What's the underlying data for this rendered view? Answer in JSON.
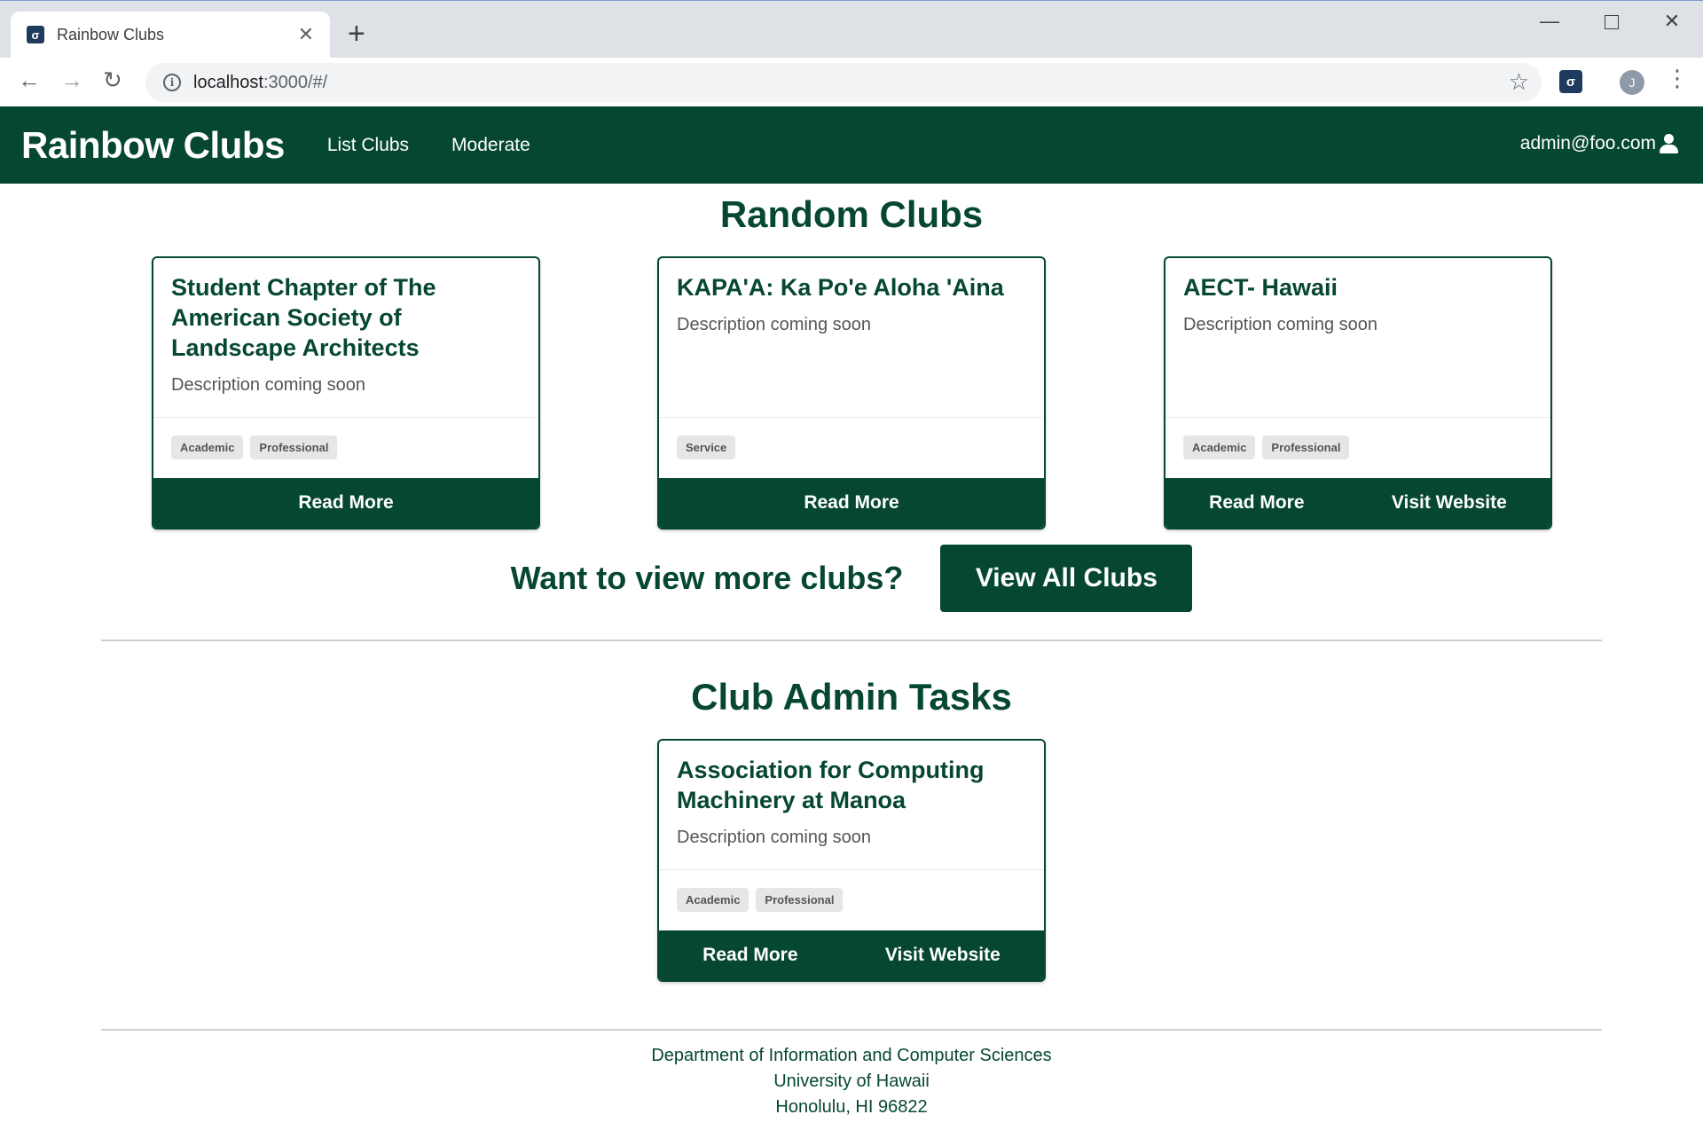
{
  "browser": {
    "tab_title": "Rainbow Clubs",
    "tab_close": "✕",
    "new_tab": "+",
    "url_host": "localhost",
    "url_rest": ":3000/#/",
    "avatar_letter": "J",
    "icons": [
      "favicon-icon",
      "close-icon",
      "plus-icon",
      "back-icon",
      "forward-icon",
      "reload-icon",
      "info-icon",
      "star-icon",
      "extension-icon",
      "profile-icon",
      "menu-icon"
    ]
  },
  "navbar": {
    "brand": "Rainbow Clubs",
    "links": [
      "List Clubs",
      "Moderate"
    ],
    "user": "admin@foo.com"
  },
  "random_clubs": {
    "title": "Random Clubs",
    "cards": [
      {
        "title": "Student Chapter of The American Society of Landscape Architects",
        "description": "Description coming soon",
        "tags": [
          "Academic",
          "Professional"
        ],
        "buttons": [
          "Read More"
        ]
      },
      {
        "title": "KAPA'A: Ka Po'e Aloha 'Aina",
        "description": "Description coming soon",
        "tags": [
          "Service"
        ],
        "buttons": [
          "Read More"
        ]
      },
      {
        "title": "AECT- Hawaii",
        "description": "Description coming soon",
        "tags": [
          "Academic",
          "Professional"
        ],
        "buttons": [
          "Read More",
          "Visit Website"
        ]
      }
    ]
  },
  "more": {
    "prompt": "Want to view more clubs?",
    "button": "View All Clubs"
  },
  "admin_tasks": {
    "title": "Club Admin Tasks",
    "cards": [
      {
        "title": "Association for Computing Machinery at Manoa",
        "description": "Description coming soon",
        "tags": [
          "Academic",
          "Professional"
        ],
        "buttons": [
          "Read More",
          "Visit Website"
        ]
      }
    ]
  },
  "footer": {
    "lines": [
      "Department of Information and Computer Sciences",
      "University of Hawaii",
      "Honolulu, HI 96822"
    ]
  },
  "colors": {
    "primary": "#064732",
    "tag_bg": "#e6e6e6",
    "chrome_bg": "#dee1e6"
  }
}
